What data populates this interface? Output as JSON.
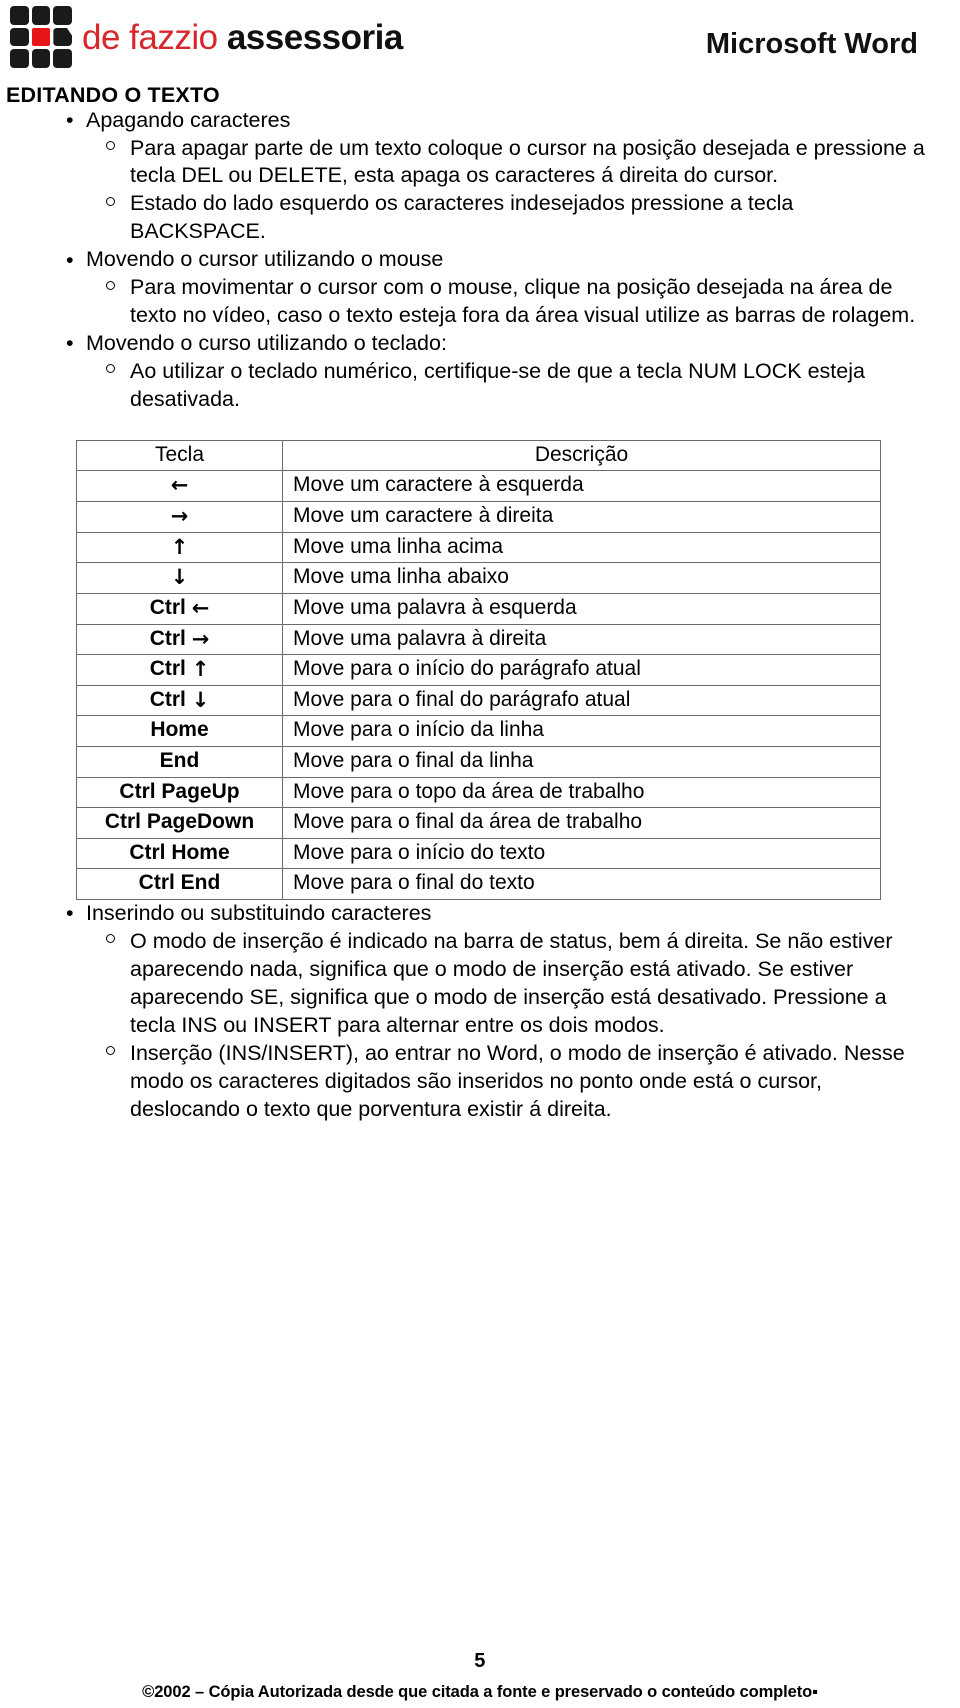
{
  "header": {
    "brand_word_1": "de fazzio",
    "brand_word_2": "assessoria",
    "logo_name": "de-fazzio-grid-logo",
    "app_title": "Microsoft Word",
    "brand_red": "#d8262b",
    "logo_black": "#1a1a1a",
    "logo_red": "#e8161b"
  },
  "section_title": "EDITANDO O TEXTO",
  "sections": [
    {
      "heading": "Apagando caracteres",
      "items": [
        "Para apagar parte de um texto coloque o cursor na posição desejada e pressione a tecla DEL ou DELETE, esta apaga os caracteres á direita do cursor.",
        "Estado do lado esquerdo os caracteres indesejados pressione a tecla BACKSPACE."
      ]
    },
    {
      "heading": "Movendo o cursor utilizando o mouse",
      "items": [
        "Para movimentar o cursor com o mouse, clique na posição desejada na área de texto no vídeo, caso o texto esteja fora da área visual utilize as barras de rolagem."
      ]
    },
    {
      "heading": "Movendo o curso utilizando o teclado:",
      "items": [
        "Ao utilizar o teclado numérico, certifique-se de que a tecla NUM LOCK esteja desativada."
      ]
    }
  ],
  "table": {
    "headers": [
      "Tecla",
      "Descrição"
    ],
    "rows": [
      {
        "key": "←",
        "key_type": "arrow",
        "bold": false,
        "desc": "Move um caractere à esquerda"
      },
      {
        "key": "→",
        "key_type": "arrow",
        "bold": false,
        "desc": "Move um caractere à direita"
      },
      {
        "key": "↑",
        "key_type": "arrow",
        "bold": false,
        "desc": "Move uma linha acima"
      },
      {
        "key": "↓",
        "key_type": "arrow",
        "bold": false,
        "desc": "Move uma linha abaixo"
      },
      {
        "key": "Ctrl ←",
        "key_type": "combo",
        "bold": true,
        "desc": "Move uma palavra à esquerda"
      },
      {
        "key": "Ctrl →",
        "key_type": "combo",
        "bold": true,
        "desc": "Move uma palavra à direita"
      },
      {
        "key": "Ctrl ↑",
        "key_type": "combo",
        "bold": true,
        "desc": "Move para o início do parágrafo atual"
      },
      {
        "key": "Ctrl ↓",
        "key_type": "combo",
        "bold": true,
        "desc": "Move para o final do parágrafo atual"
      },
      {
        "key": "Home",
        "key_type": "text",
        "bold": true,
        "desc": "Move para o início da linha"
      },
      {
        "key": "End",
        "key_type": "text",
        "bold": true,
        "desc": "Move para o final da linha"
      },
      {
        "key": "Ctrl PageUp",
        "key_type": "text",
        "bold": true,
        "desc": "Move para o topo da área de trabalho"
      },
      {
        "key": "Ctrl PageDown",
        "key_type": "text",
        "bold": true,
        "desc": "Move para o final da área de trabalho"
      },
      {
        "key": "Ctrl Home",
        "key_type": "text",
        "bold": true,
        "desc": "Move para o início do texto"
      },
      {
        "key": "Ctrl End",
        "key_type": "text",
        "bold": true,
        "desc": "Move para o final do texto"
      }
    ]
  },
  "bottom_section": {
    "heading": "Inserindo ou substituindo caracteres",
    "items": [
      "O modo de inserção é indicado na barra de status, bem á direita. Se não estiver aparecendo nada, significa que o modo de inserção está ativado. Se estiver aparecendo SE, significa que o modo de inserção está desativado. Pressione a tecla INS ou INSERT para alternar entre os dois modos.",
      "Inserção (INS/INSERT), ao entrar no Word, o modo de inserção é ativado. Nesse modo os caracteres digitados são inseridos no ponto onde está o cursor, deslocando o texto que porventura existir á direita."
    ]
  },
  "footer": {
    "page_number": "5",
    "copyright": "©2002 – Cópia Autorizada desde que citada a fonte e preservado o conteúdo completo▪"
  }
}
